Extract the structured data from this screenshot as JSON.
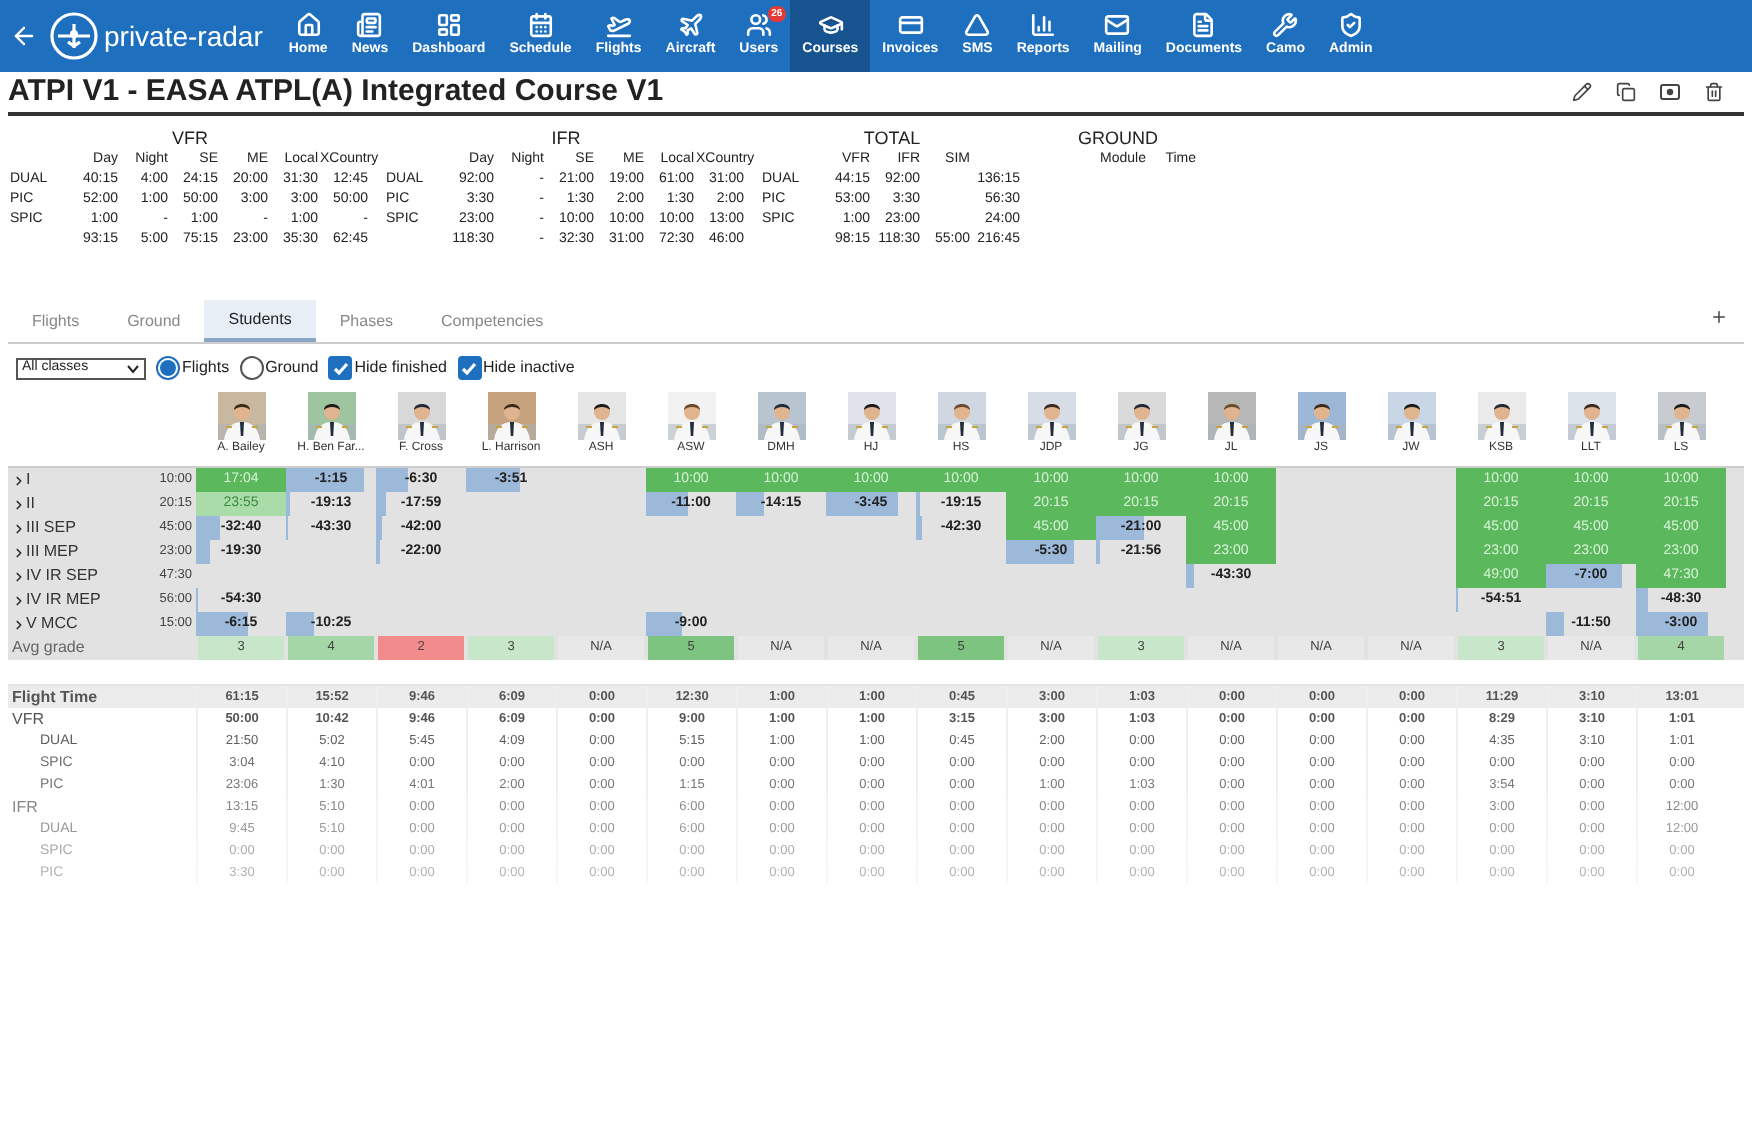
{
  "app": {
    "brand": "private-radar"
  },
  "nav": [
    {
      "label": "Home",
      "selected": false
    },
    {
      "label": "News",
      "selected": false
    },
    {
      "label": "Dashboard",
      "selected": false
    },
    {
      "label": "Schedule",
      "selected": false
    },
    {
      "label": "Flights",
      "selected": false
    },
    {
      "label": "Aircraft",
      "selected": false
    },
    {
      "label": "Users",
      "selected": false,
      "badge": "26"
    },
    {
      "label": "Courses",
      "selected": true
    },
    {
      "label": "Invoices",
      "selected": false
    },
    {
      "label": "SMS",
      "selected": false
    },
    {
      "label": "Reports",
      "selected": false
    },
    {
      "label": "Mailing",
      "selected": false
    },
    {
      "label": "Documents",
      "selected": false
    },
    {
      "label": "Camo",
      "selected": false
    },
    {
      "label": "Admin",
      "selected": false
    }
  ],
  "page": {
    "title": "ATPI V1 - EASA ATPL(A) Integrated Course V1"
  },
  "summary": [
    {
      "title": "VFR",
      "columns": [
        "Day",
        "Night",
        "SE",
        "ME",
        "Local",
        "XCountry"
      ],
      "rows": [
        {
          "label": "DUAL",
          "values": [
            "40:15",
            "4:00",
            "24:15",
            "20:00",
            "31:30",
            "12:45"
          ]
        },
        {
          "label": "PIC",
          "values": [
            "52:00",
            "1:00",
            "50:00",
            "3:00",
            "3:00",
            "50:00"
          ]
        },
        {
          "label": "SPIC",
          "values": [
            "1:00",
            "-",
            "1:00",
            "-",
            "1:00",
            "-"
          ]
        },
        {
          "values": [
            "93:15",
            "5:00",
            "75:15",
            "23:00",
            "35:30",
            "62:45"
          ]
        }
      ]
    },
    {
      "title": "IFR",
      "columns": [
        "Day",
        "Night",
        "SE",
        "ME",
        "Local",
        "XCountry"
      ],
      "rows": [
        {
          "label": "DUAL",
          "values": [
            "92:00",
            "-",
            "21:00",
            "19:00",
            "61:00",
            "31:00"
          ]
        },
        {
          "label": "PIC",
          "values": [
            "3:30",
            "-",
            "1:30",
            "2:00",
            "1:30",
            "2:00"
          ]
        },
        {
          "label": "SPIC",
          "values": [
            "23:00",
            "-",
            "10:00",
            "10:00",
            "10:00",
            "13:00"
          ]
        },
        {
          "values": [
            "118:30",
            "-",
            "32:30",
            "31:00",
            "72:30",
            "46:00"
          ]
        }
      ]
    },
    {
      "title": "TOTAL",
      "columns": [
        "VFR",
        "IFR",
        "SIM"
      ],
      "rows": [
        {
          "label": "DUAL",
          "values": [
            "44:15",
            "92:00"
          ],
          "total": "136:15"
        },
        {
          "label": "PIC",
          "values": [
            "53:00",
            "3:30"
          ],
          "total": "56:30"
        },
        {
          "label": "SPIC",
          "values": [
            "1:00",
            "23:00"
          ],
          "total": "24:00"
        },
        {
          "values": [
            "98:15",
            "118:30",
            "55:00"
          ],
          "total": "216:45"
        }
      ]
    },
    {
      "title": "GROUND",
      "columns": [
        "Module",
        "Time"
      ]
    }
  ],
  "tabs": [
    {
      "label": "Flights",
      "selected": false
    },
    {
      "label": "Ground",
      "selected": false
    },
    {
      "label": "Students",
      "selected": true
    },
    {
      "label": "Phases",
      "selected": false
    },
    {
      "label": "Competencies",
      "selected": false
    }
  ],
  "filters": {
    "class_select": "All classes",
    "radios": [
      {
        "label": "Flights",
        "selected": true
      },
      {
        "label": "Ground",
        "selected": false
      }
    ],
    "checkboxes": [
      {
        "label": "Hide finished",
        "checked": true
      },
      {
        "label": "Hide inactive",
        "checked": true
      }
    ]
  },
  "students": [
    "A. Bailey",
    "H. Ben Far...",
    "F. Cross",
    "L. Harrison",
    "ASH",
    "ASW",
    "DMH",
    "HJ",
    "HS",
    "JDP",
    "JG",
    "JL",
    "JS",
    "JW",
    "KSB",
    "LLT",
    "LS"
  ],
  "phases": [
    {
      "label": "I",
      "required": "10:00",
      "cells": [
        {
          "kind": "done",
          "value": "17:04"
        },
        {
          "kind": "progress",
          "value": "-1:15",
          "level": 0.87
        },
        {
          "kind": "progress",
          "value": "-6:30",
          "level": 0.35
        },
        {
          "kind": "progress",
          "value": "-3:51",
          "level": 0.6
        },
        null,
        {
          "kind": "done",
          "value": "10:00"
        },
        {
          "kind": "done",
          "value": "10:00"
        },
        {
          "kind": "done",
          "value": "10:00"
        },
        {
          "kind": "done",
          "value": "10:00"
        },
        {
          "kind": "done",
          "value": "10:00"
        },
        {
          "kind": "done",
          "value": "10:00"
        },
        {
          "kind": "done",
          "value": "10:00"
        },
        null,
        null,
        {
          "kind": "done",
          "value": "10:00"
        },
        {
          "kind": "done",
          "value": "10:00"
        },
        {
          "kind": "done",
          "value": "10:00"
        }
      ]
    },
    {
      "label": "II",
      "required": "20:15",
      "cells": [
        {
          "kind": "surplus",
          "value": "23:55"
        },
        {
          "kind": "progress",
          "value": "-19:13",
          "level": 0.05
        },
        {
          "kind": "progress",
          "value": "-17:59",
          "level": 0.11
        },
        null,
        null,
        {
          "kind": "progress",
          "value": "-11:00",
          "level": 0.46
        },
        {
          "kind": "progress",
          "value": "-14:15",
          "level": 0.3
        },
        {
          "kind": "progress",
          "value": "-3:45",
          "level": 0.81
        },
        {
          "kind": "progress",
          "value": "-19:15",
          "level": 0.05
        },
        {
          "kind": "done",
          "value": "20:15"
        },
        {
          "kind": "done",
          "value": "20:15"
        },
        {
          "kind": "done",
          "value": "20:15"
        },
        null,
        null,
        {
          "kind": "done",
          "value": "20:15"
        },
        {
          "kind": "done",
          "value": "20:15"
        },
        {
          "kind": "done",
          "value": "20:15"
        }
      ]
    },
    {
      "label": "III SEP",
      "required": "45:00",
      "cells": [
        {
          "kind": "progress",
          "value": "-32:40",
          "level": 0.27
        },
        {
          "kind": "progress",
          "value": "-43:30",
          "level": 0.03
        },
        {
          "kind": "progress",
          "value": "-42:00",
          "level": 0.07
        },
        null,
        null,
        null,
        null,
        null,
        {
          "kind": "progress",
          "value": "-42:30",
          "level": 0.06
        },
        {
          "kind": "done",
          "value": "45:00"
        },
        {
          "kind": "progress",
          "value": "-21:00",
          "level": 0.53
        },
        {
          "kind": "done",
          "value": "45:00"
        },
        null,
        null,
        {
          "kind": "done",
          "value": "45:00"
        },
        {
          "kind": "done",
          "value": "45:00"
        },
        {
          "kind": "done",
          "value": "45:00"
        }
      ]
    },
    {
      "label": "III MEP",
      "required": "23:00",
      "cells": [
        {
          "kind": "progress",
          "value": "-19:30",
          "level": 0.15
        },
        null,
        {
          "kind": "progress",
          "value": "-22:00",
          "level": 0.04
        },
        null,
        null,
        null,
        null,
        null,
        null,
        {
          "kind": "progress",
          "value": "-5:30",
          "level": 0.76
        },
        {
          "kind": "progress",
          "value": "-21:56",
          "level": 0.05
        },
        {
          "kind": "done",
          "value": "23:00"
        },
        null,
        null,
        {
          "kind": "done",
          "value": "23:00"
        },
        {
          "kind": "done",
          "value": "23:00"
        },
        {
          "kind": "done",
          "value": "23:00"
        }
      ]
    },
    {
      "label": "IV IR SEP",
      "required": "47:30",
      "cells": [
        null,
        null,
        null,
        null,
        null,
        null,
        null,
        null,
        null,
        null,
        null,
        {
          "kind": "progress",
          "value": "-43:30",
          "level": 0.08
        },
        null,
        null,
        {
          "kind": "done",
          "value": "49:00"
        },
        {
          "kind": "progress",
          "value": "-7:00",
          "level": 0.85
        },
        {
          "kind": "done",
          "value": "47:30"
        }
      ]
    },
    {
      "label": "IV IR MEP",
      "required": "56:00",
      "cells": [
        {
          "kind": "progress",
          "value": "-54:30",
          "level": 0.03
        },
        null,
        null,
        null,
        null,
        null,
        null,
        null,
        null,
        null,
        null,
        null,
        null,
        null,
        {
          "kind": "progress",
          "value": "-54:51",
          "level": 0.02
        },
        null,
        {
          "kind": "progress",
          "value": "-48:30",
          "level": 0.13
        }
      ]
    },
    {
      "label": "V MCC",
      "required": "15:00",
      "cells": [
        {
          "kind": "progress",
          "value": "-6:15",
          "level": 0.58
        },
        {
          "kind": "progress",
          "value": "-10:25",
          "level": 0.3
        },
        null,
        null,
        null,
        {
          "kind": "progress",
          "value": "-9:00",
          "level": 0.4
        },
        null,
        null,
        null,
        null,
        null,
        null,
        null,
        null,
        null,
        {
          "kind": "progress",
          "value": "-11:50",
          "level": 0.21
        },
        {
          "kind": "progress",
          "value": "-3:00",
          "level": 0.8
        }
      ]
    }
  ],
  "avg_grade": {
    "label": "Avg grade",
    "cells": [
      {
        "value": "3",
        "color": "#c8e6c9"
      },
      {
        "value": "4",
        "color": "#a5d6a7"
      },
      {
        "value": "2",
        "color": "#f28b8b"
      },
      {
        "value": "3",
        "color": "#c8e6c9"
      },
      {
        "value": "N/A",
        "color": "#e8e8e8"
      },
      {
        "value": "5",
        "color": "#7cc47f"
      },
      {
        "value": "N/A",
        "color": "#e8e8e8"
      },
      {
        "value": "N/A",
        "color": "#e8e8e8"
      },
      {
        "value": "5",
        "color": "#7cc47f"
      },
      {
        "value": "N/A",
        "color": "#e8e8e8"
      },
      {
        "value": "3",
        "color": "#c8e6c9"
      },
      {
        "value": "N/A",
        "color": "#e8e8e8"
      },
      {
        "value": "N/A",
        "color": "#e8e8e8"
      },
      {
        "value": "N/A",
        "color": "#e8e8e8"
      },
      {
        "value": "3",
        "color": "#c8e6c9"
      },
      {
        "value": "N/A",
        "color": "#e8e8e8"
      },
      {
        "value": "4",
        "color": "#a5d6a7"
      }
    ]
  },
  "hours": [
    {
      "label": "Flight Time",
      "values": [
        "61:15",
        "15:52",
        "9:46",
        "6:09",
        "0:00",
        "12:30",
        "1:00",
        "1:00",
        "0:45",
        "3:00",
        "1:03",
        "0:00",
        "0:00",
        "0:00",
        "11:29",
        "3:10",
        "13:01"
      ]
    },
    {
      "label": "VFR",
      "values": [
        "50:00",
        "10:42",
        "9:46",
        "6:09",
        "0:00",
        "9:00",
        "1:00",
        "1:00",
        "3:15",
        "3:00",
        "1:03",
        "0:00",
        "0:00",
        "0:00",
        "8:29",
        "3:10",
        "1:01"
      ],
      "children": [
        {
          "label": "DUAL",
          "values": [
            "21:50",
            "5:02",
            "5:45",
            "4:09",
            "0:00",
            "5:15",
            "1:00",
            "1:00",
            "0:45",
            "2:00",
            "0:00",
            "0:00",
            "0:00",
            "0:00",
            "4:35",
            "3:10",
            "1:01"
          ]
        },
        {
          "label": "SPIC",
          "values": [
            "3:04",
            "4:10",
            "0:00",
            "0:00",
            "0:00",
            "0:00",
            "0:00",
            "0:00",
            "0:00",
            "0:00",
            "0:00",
            "0:00",
            "0:00",
            "0:00",
            "0:00",
            "0:00",
            "0:00"
          ]
        },
        {
          "label": "PIC",
          "values": [
            "23:06",
            "1:30",
            "4:01",
            "2:00",
            "0:00",
            "1:15",
            "0:00",
            "0:00",
            "0:00",
            "1:00",
            "1:03",
            "0:00",
            "0:00",
            "0:00",
            "3:54",
            "0:00",
            "0:00"
          ]
        }
      ]
    },
    {
      "label": "IFR",
      "values": [
        "13:15",
        "5:10",
        "0:00",
        "0:00",
        "0:00",
        "6:00",
        "0:00",
        "0:00",
        "0:00",
        "0:00",
        "0:00",
        "0:00",
        "0:00",
        "0:00",
        "3:00",
        "0:00",
        "12:00"
      ],
      "children": [
        {
          "label": "DUAL",
          "values": [
            "9:45",
            "5:10",
            "0:00",
            "0:00",
            "0:00",
            "6:00",
            "0:00",
            "0:00",
            "0:00",
            "0:00",
            "0:00",
            "0:00",
            "0:00",
            "0:00",
            "0:00",
            "0:00",
            "12:00"
          ]
        },
        {
          "label": "SPIC",
          "values": [
            "0:00",
            "0:00",
            "0:00",
            "0:00",
            "0:00",
            "0:00",
            "0:00",
            "0:00",
            "0:00",
            "0:00",
            "0:00",
            "0:00",
            "0:00",
            "0:00",
            "0:00",
            "0:00",
            "0:00"
          ]
        },
        {
          "label": "PIC",
          "values": [
            "3:30",
            "0:00",
            "0:00",
            "0:00",
            "0:00",
            "0:00",
            "0:00",
            "0:00",
            "0:00",
            "0:00",
            "0:00",
            "0:00",
            "0:00",
            "0:00",
            "0:00",
            "0:00",
            "0:00"
          ]
        }
      ]
    }
  ]
}
